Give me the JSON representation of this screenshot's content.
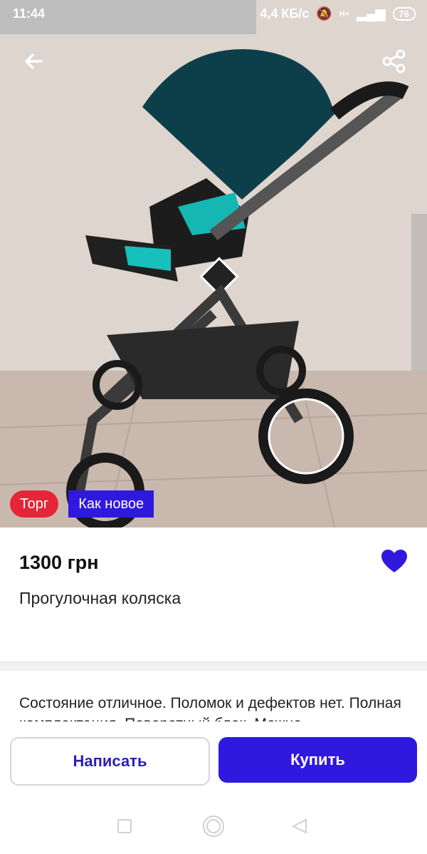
{
  "status_bar": {
    "time": "11:44",
    "network_speed": "4,4 КБ/с",
    "signal_label": "H+",
    "battery": "76"
  },
  "listing": {
    "badges": [
      "Торг",
      "Как новое"
    ],
    "price": "1300 грн",
    "title": "Прогулочная коляска",
    "description": "Состояние отличное. Поломок и дефектов нет. Полная комплектация. Поворотный блок. Можно",
    "favorite": true
  },
  "actions": {
    "write_label": "Написать",
    "buy_label": "Купить"
  },
  "colors": {
    "accent": "#2f19df",
    "torg_badge": "#e5263a",
    "heart": "#2f19df"
  },
  "icons": {
    "back": "back-arrow-icon",
    "share": "share-icon",
    "heart": "heart-icon"
  }
}
